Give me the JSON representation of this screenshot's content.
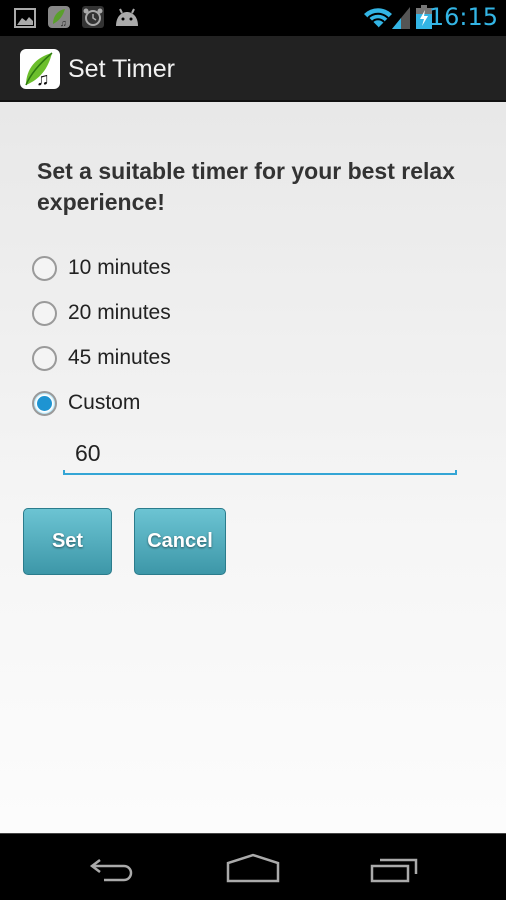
{
  "status_bar": {
    "notification_icons": [
      "gallery-icon",
      "relax-app-icon",
      "alarm-clock-icon",
      "android-icon"
    ],
    "system_icons": [
      "wifi-icon",
      "signal-icon",
      "battery-charging-icon"
    ],
    "time": "16:15",
    "accent_color": "#33b5e5"
  },
  "action_bar": {
    "title": "Set Timer"
  },
  "main": {
    "heading": "Set a suitable timer for your best relax experience!",
    "options": [
      {
        "label": "10 minutes",
        "checked": false
      },
      {
        "label": "20 minutes",
        "checked": false
      },
      {
        "label": "45 minutes",
        "checked": false
      },
      {
        "label": "Custom",
        "checked": true
      }
    ],
    "custom_value": "60",
    "set_label": "Set",
    "cancel_label": "Cancel"
  },
  "nav_bar": {
    "buttons": [
      "back-icon",
      "home-icon",
      "recents-icon"
    ]
  }
}
